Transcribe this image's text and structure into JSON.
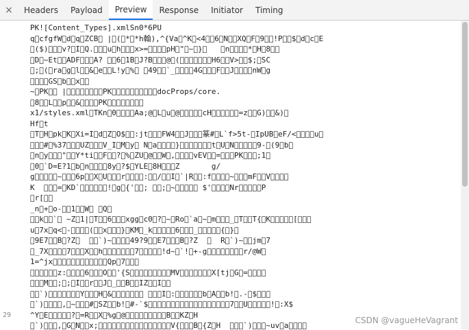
{
  "tabs": {
    "close": "×",
    "items": [
      {
        "label": "Headers"
      },
      {
        "label": "Payload"
      },
      {
        "label": "Preview"
      },
      {
        "label": "Response"
      },
      {
        "label": "Initiator"
      },
      {
        "label": "Timing"
      }
    ]
  },
  "preview": {
    "line_numbers": [
      "",
      "",
      "",
      "",
      "",
      "",
      "",
      "",
      "",
      "",
      "",
      "",
      "",
      "",
      "",
      "",
      "",
      "",
      "",
      "",
      "",
      "",
      "",
      "",
      "",
      "",
      "",
      "29"
    ],
    "rows": [
      "PK\u0003\u0004\u0014\u0000\u0000\u0000\u0000\u0000\u0000\u0000!\u0000[Content_Types].xml\u0000S\u0000n\u00000\u0000\u0000\u0000\u0000\u0000*6PU",
      "q\u0000cfgfW\u0000d\u0000q\u0000ZCB\u0000 |\u0000(\u0000*\u0000*h翰),^{Va\u0000^K\u0000<4\u0000\u00006\u0000N\u0000\u0000XQ\u0000F\u00009\u0000\u0000!P\u0000\u0000$\u0000d\u0000c\u0000E",
      "\u0000($)\u0000\u0000\u0000v?\u0000I\u0000Q.\u0000\u0000\u0000u\u0000h\u0000\u0000\u0000x>=\u0000\u0000\u0000\u0000pH\u0000\"\u0000~\u0000}\u0000   \u0000n\u0000\u0000\u0000\u0000*\u0000H\u00008\u0000\u0000",
      "\u0000D\u0000~Et\u0000\u0000ADF\u0000\u0000\u0000A? \u0000\u00006\u00001B\u0000J?B\u0000\u0000\u0000@\u0000(\u0000\u0000\u0000\u0000\u0000\u0000\u0000H6\u0000\u0000V>\u0000\u0000$;\u0000SC",
      "\u0000;\u0000(\u0000ra\u0000g\u0000l\u0000\u0000&\u0000e\u0000\u0000L!y\u0000%\u0000 \u000049\u0000\u0000`_\u0000\u0000\u0000\u00004G\u0000\u0000\u0000F\u0000\u0000J\u0000\u0000\u0000\u0000nW\u0000g",
      "\u0000\u0000\u0000\u0000GS\u0000b\u0000\u0000x\u0000\u0000",
      "~\u0000PK\u0000\u0000 |\u0000\u0000\u0000\u0000\u0000\u0000\u0000\u0000PK\u0003\u0004\u0000\u0000\u0000\u0000\u0000\u0000\u0000\u0000docProps/core.",
      "\u00008\u0000\u0000L\u0000\u0000p\u0000\u0000&\u0000\u0000\u0000\u0000PK\u0003\u0004\u0000\u0000\u0000\u0000\u0000\u0000",
      "x1/styles.xml\u0000TKn\u00000\u0000\u0000\u0000\u0000Aa;@\u0000L\u0000u\u0000@\u0000\u0000\u0000\u0000\u0000cH\u0000\u0000\u0000\u0000\u0000\u0000=z\u0000\u0000G)\u0000\u0000&)\u0000",
      "Hf\u0000t",
      "\u0000T\u0000H\u0000pk\u0000K\u0000Xi=I\u0000d\u0000Z\u0000O$\u0000\u0000:jt\u0000\u0000\u0000FW4\u0000\u0000J\u0000\u0000\u0000篆#\u0000L`f>5t-\u0000IpUB\u0000eF/<\u0000\u0000\u0000\u0000u\u0000",
      "\u0000\u0000\u0000#\u0000%37\u0000\u0000\u0000UZ\u0000\u0000\u0000V_I\u0000M\u0000y\u0000 N\u0000a\u0000\u0000\u0000\u0000}\u0000\u0000\u0000\u0000\u0000\u0000\u0000t\u0000U\u0000N\u0000\u0000\u0000\u0000\u00009-\u0000(9\u0000b\u0000",
      "\u0000n\u0000y\u0000\u0000\u0000\"\u0000\u0000Y*ti\u0000\u0000F\u0000\u0000?\u0000%\u0000ZU\u0000@\u0000\u0000W\u0000,\u0000\u0000\u0000\u0000vEV\u0000\u0000=\u0000\u0000\u0000PK\u0000\u0000\u0000;1\u0000",
      "\u00000\u0000`D=E?1\u0000b\u0000n\u0000\u0000\u0000\u00008y\u0000?$\u0000YLE\u00008H\u0000\u0000\u0000Z       g/",
      "g\u0000\u0000\u0000\u0000\u0000~\u0000\u0000\u00006p\u0000\u0000X\u0000U\u0000\u0000\u0000r\u0000\u0000\u0000\u0000:\u0000\u0000/\u0000\u0000I\u0000`|R\u0000\u0000:f\u0000\u0000\u0000\u0000~\u0000\u0000\u0000mF\u0000\u0000V\u0000\u0000\u0000\u0000",
      "K  \u0000\u0000\u0000=\u0000KD`\u0000\u0000\u0000\u0000\u0000\u0000!\u0000g\u0000{'\u0000\u0000; \u0000\u0000;\u0000~\u0000\u0000\u0000\u0000\u0000 $'\u0000\u0000\u0000\u0000Nr\u0000\u0000\u0000\u0000\u0000P",
      "\u0000r[\u0000\u0000",
      "_n\u0000+\u0000o-\u0000\u00001\u0000\u0000W\u0000 \u0000Q\u0000",
      "\u0000\u0000k\u0000\u0000`\u0000 ~Z\u00001|\u0000T\u0000\u00006\u0000\u0000\u0000xgg\u0000c0\u0000?\u0000~\u0000Ro\u0000`a\u0000~\u0000m\u0000\u0000\u0000_\u0000T\u0000\u0000T{\u0000K\u0000\u0000\u0000\u0000\u0000[\u0000\u0000\u0000",
      "u\u00007x\u0000q<\u0000-\u0000\u0000\u0000\u0000(\u0000\u0000x\u0000\u0000\u0000}\u0000KM\u0000_k\u0000\u0000\u0000\u0000\u00006\u0000\u0000\u0000_\u0000\u0000\u0000\u0000\u0000{\u0000}\u0000",
      "\u00009E7\u0000\u0000B\u0000?Z\u0000  \u0000\u0000`)~\u0000\u0000\u0000\u000049?9\u0000\u0000E7\u0000\u0000\u0000B\u0000?Z  \u0000  R\u0000`)~\u0000\u0000jm\u00007",
      "\u0000_7X\u0000\u0000\u0000\u00007\u0000\u0000\u0000X\u0000\u0000h\u0000\u0000\u0000\u0000\u0000\u0000\u00007\u0000\u0000\u0000\u0000\u0000!d~\u0000`!\u0000+-g\u0000\u0000\u0000\u0000\u0000\u0000\u0000\u0000r/@W\u0000",
      "1=^jx\u0000\u0000\u0000\u0000\u0000\u0000\u0000\u0000\u0000\u0000\u0000\u0000Qp\u00007\u0000\u0000\u0000",
      "\u0000\u0000\u0000\u0000\u0000\u0000z:\u0000\u0000\u0000\u00006\u0000\u0000\u0000O\u0000\u0000'{S\u0000\u0000\u0000\u0000\u0000\u0000\u0000\u0000\u0000MV\u0000\u0000\u0000\u0000\u0000\u0000\u0000X[tj\u0000G\u0000=\u0000\u0000\u0000\u0000",
      "\u0000\u0000\u0000M\u0000\u0000;\u0000;\u0000I\u0000\u0000r\u0000\u0000J\u0000_\u0000\u0000B\u0000\u0000IZ\u0000\u0000I\u0000\u0000",
      "\u0000\u0000`)\u0000\u0000\u0000\u0000\u0000\u0000\u0000Y\u0000\u0000\u0000H\u0000&\u0000\u0000\u0000\u0000\u0000\u0000\u0000 \u0000\u0000\u0000I\u0000:\u0000\u0000\u0000\u0000\u0000\u0000b\u0000A\u0000\u0000b!\u0000.-\u0000$\u0000\u0000\u0000",
      "\u0000`)\u0000\u0000\u0000\u0000,\u0000~\u0000\u0000\u0000#\u0000SZ\u0000\u0000b!\u0000#-`$\u0000\u0000\u0000\u0000\u0000\u0000\u0000\u0000\u0000\u0000\u0000\u0000\u0000\u0000\u0000\u0000\u0000\u00007\u0000\u0000U\u0000\u0000\u0000\u0000\u0000!\u0000:X$",
      "^Y\u0000E\u0000\u0000\u0000\u0000\u0000?\u0000=R\u0000\u0000X\u0000%g\u0000@\u0000\u0000\u0000\u0000\u0000\u0000\u0000\u0000\u0000B\u0000\u0000KZ\u0000H",
      "\u0000`)\u0000\u0000\u0000,\u0000G\u0000N\u0000\u0000x;\u0000\u0000\u0000\u0000\u0000\u0000\u0000\u0000\u0000\u0000\u0000\u0000\u0000\u0000\u0000\u0000V{\u0000\u0000\u0000B\u0000{Z\u0000H  \u0000\u0000\u0000`)\u0000\u0000\u0000~uv\u0000a\u0000\u0000\u0000\u0000"
    ],
    "watermark": "CSDN @vagueHeVagrant"
  }
}
